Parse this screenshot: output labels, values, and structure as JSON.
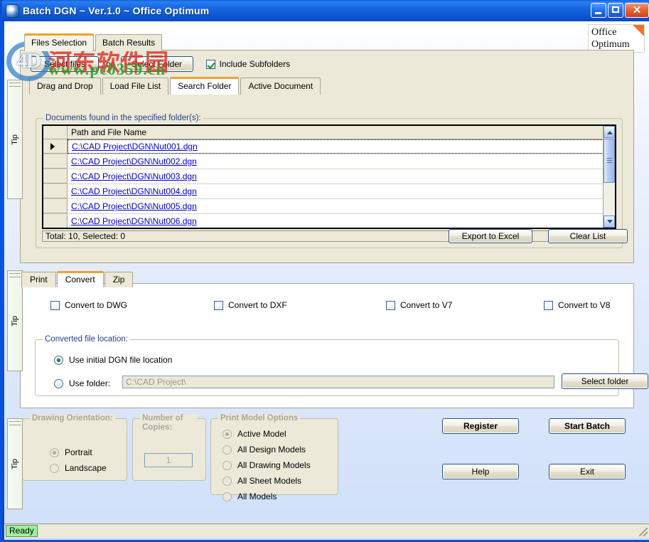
{
  "window": {
    "title": "Batch DGN ~ Ver.1.0 ~ Office Optimum",
    "icon": "app-icon",
    "minimize_label": "",
    "maximize_label": "",
    "close_label": "✕"
  },
  "brand": {
    "line1": "Office",
    "line2": "Optimum"
  },
  "watermark": {
    "logo_text": "4D",
    "chinese": "河东软件园",
    "url": "www.pc0359.cn"
  },
  "top_tabs": [
    {
      "label": "Files Selection",
      "active": true
    },
    {
      "label": "Batch Results",
      "active": false
    }
  ],
  "sub_tabs": [
    {
      "label": "Drag and Drop",
      "active": false
    },
    {
      "label": "Load File List",
      "active": false
    },
    {
      "label": "Search Folder",
      "active": true
    },
    {
      "label": "Active Document",
      "active": false
    }
  ],
  "files_selection": {
    "select_files_label": "Select files",
    "or_label": "or",
    "select_folder_label": "Select Folder",
    "include_subfolders_label": "Include Subfolders",
    "include_subfolders_checked": true,
    "group_legend": "Documents found in the specified folder(s):",
    "column_header": "Path and File Name",
    "rows": [
      {
        "path": "C:\\CAD Project\\DGN\\Nut001.dgn",
        "current": true
      },
      {
        "path": "C:\\CAD Project\\DGN\\Nut002.dgn",
        "current": false
      },
      {
        "path": "C:\\CAD Project\\DGN\\Nut003.dgn",
        "current": false
      },
      {
        "path": "C:\\CAD Project\\DGN\\Nut004.dgn",
        "current": false
      },
      {
        "path": "C:\\CAD Project\\DGN\\Nut005.dgn",
        "current": false
      },
      {
        "path": "C:\\CAD Project\\DGN\\Nut006.dgn",
        "current": false
      }
    ],
    "total_text": "Total: 10, Selected: 0",
    "export_label": "Export to Excel",
    "clear_label": "Clear List"
  },
  "bottom_tabs": [
    {
      "label": "Print",
      "active": false
    },
    {
      "label": "Convert",
      "active": true
    },
    {
      "label": "Zip",
      "active": false
    }
  ],
  "convert": {
    "options": [
      {
        "label": "Convert to DWG",
        "checked": false
      },
      {
        "label": "Convert to DXF",
        "checked": false
      },
      {
        "label": "Convert to V7",
        "checked": false
      },
      {
        "label": "Convert to V8",
        "checked": false
      }
    ],
    "location_legend": "Converted file location:",
    "use_initial_label": "Use initial DGN file location",
    "use_initial_selected": true,
    "use_folder_label": "Use folder:",
    "use_folder_selected": false,
    "folder_value": "C:\\CAD Project\\",
    "select_folder_label": "Select folder"
  },
  "print_options": {
    "orientation_legend": "Drawing Orientation:",
    "orientation": [
      {
        "label": "Portrait",
        "selected": true
      },
      {
        "label": "Landscape",
        "selected": false
      }
    ],
    "copies_legend": "Number of Copies:",
    "copies_value": "1",
    "model_legend": "Print Model Options",
    "models": [
      {
        "label": "Active Model",
        "selected": true
      },
      {
        "label": "All Design Models",
        "selected": false
      },
      {
        "label": "All Drawing Models",
        "selected": false
      },
      {
        "label": "All Sheet Models",
        "selected": false
      },
      {
        "label": "All Models",
        "selected": false
      }
    ]
  },
  "action_buttons": {
    "register": "Register",
    "start_batch": "Start Batch",
    "help": "Help",
    "exit": "Exit"
  },
  "tips": [
    {
      "label": "Tip"
    },
    {
      "label": "Tip"
    },
    {
      "label": "Tip"
    }
  ],
  "statusbar": {
    "text": "Ready"
  }
}
